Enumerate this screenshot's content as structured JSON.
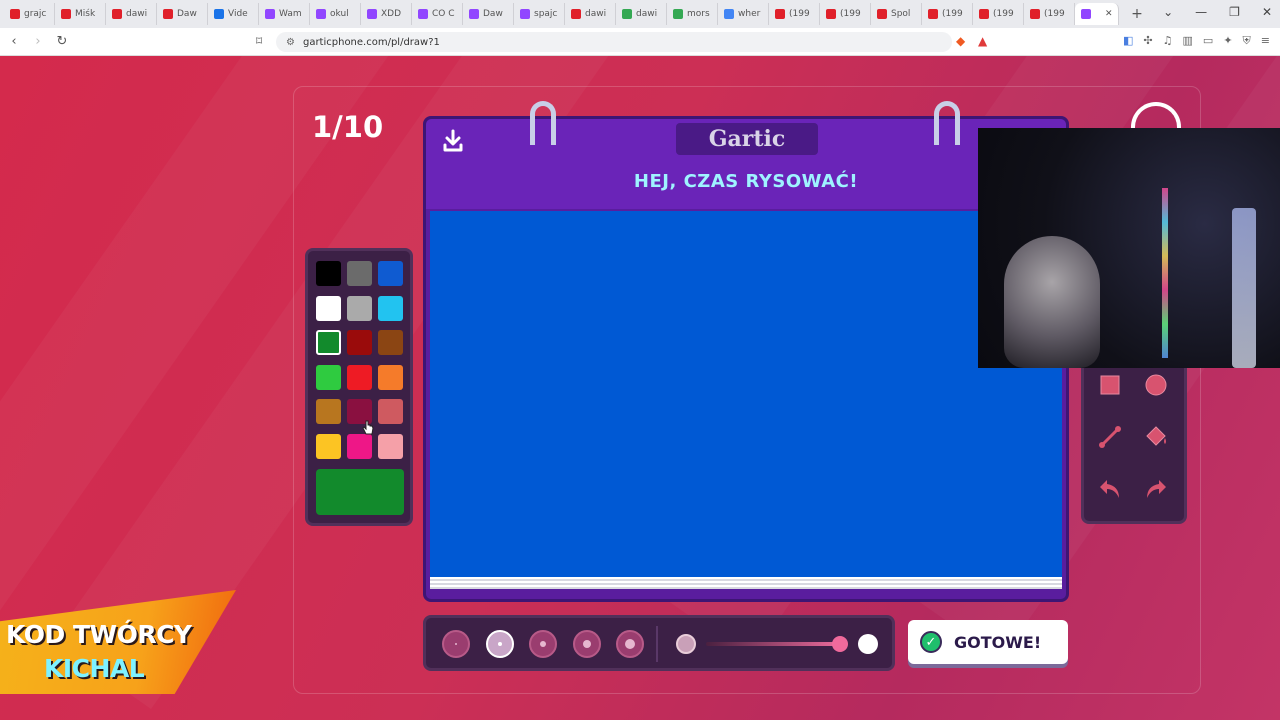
{
  "browser": {
    "tabs": [
      {
        "label": "grajc",
        "color": "#e0202a"
      },
      {
        "label": "Miśk",
        "color": "#e0202a"
      },
      {
        "label": "dawi",
        "color": "#e0202a"
      },
      {
        "label": "Daw",
        "color": "#e0202a"
      },
      {
        "label": "Vide",
        "color": "#1a73e8"
      },
      {
        "label": "Wam",
        "color": "#9146ff"
      },
      {
        "label": "okul",
        "color": "#9146ff"
      },
      {
        "label": "XDD",
        "color": "#9146ff"
      },
      {
        "label": "CO C",
        "color": "#9146ff"
      },
      {
        "label": "Daw",
        "color": "#9146ff"
      },
      {
        "label": "spajc",
        "color": "#9146ff"
      },
      {
        "label": "dawi",
        "color": "#e0202a"
      },
      {
        "label": "dawi",
        "color": "#34a853"
      },
      {
        "label": "mors",
        "color": "#34a853"
      },
      {
        "label": "wher",
        "color": "#4285f4"
      },
      {
        "label": "(199",
        "color": "#e0202a"
      },
      {
        "label": "(199",
        "color": "#e0202a"
      },
      {
        "label": "Spol",
        "color": "#e0202a"
      },
      {
        "label": "(199",
        "color": "#e0202a"
      },
      {
        "label": "(199",
        "color": "#e0202a"
      },
      {
        "label": "(199",
        "color": "#e0202a"
      },
      {
        "label": "",
        "color": "#9146ff",
        "active": true
      }
    ],
    "new_tab": "+",
    "url": "garticphone.com/pl/draw?1"
  },
  "game": {
    "round": "1/10",
    "logo": "Gartic",
    "title": "HEJ, CZAS RYSOWAĆ!",
    "canvas_color": "#0059d4",
    "palette": [
      [
        "#000000",
        "#6b6b6b",
        "#0f5bd1"
      ],
      [
        "#ffffff",
        "#aaaaaa",
        "#22c3f0"
      ],
      [
        "#128a2c",
        "#9a0b0b",
        "#8b4513"
      ],
      [
        "#2fcb40",
        "#ee1b24",
        "#f57b2a"
      ],
      [
        "#b8761f",
        "#8a1040",
        "#cf5a60"
      ],
      [
        "#fcc423",
        "#ee1787",
        "#f5a0a8"
      ]
    ],
    "selected_color": "#128a2c",
    "done_label": "GOTOWE!",
    "stroke_sizes": 5,
    "active_stroke": 1
  },
  "creator_code": {
    "line1": "KOD TWÓRCY",
    "line2": "KICHAL"
  }
}
